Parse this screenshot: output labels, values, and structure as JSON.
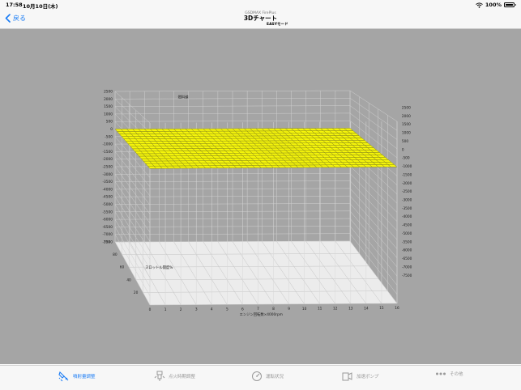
{
  "status": {
    "time": "17:58",
    "date": "10月10日(木)",
    "battery": "100%"
  },
  "nav": {
    "back_label": "戻る",
    "subtitle": "GSDMAX FirePlus",
    "title": "3Dチャート",
    "mode": "EASYモード"
  },
  "chart_data": {
    "type": "surface3d",
    "title": "燃料値",
    "xlabel": "エンジン回転数×4000rpm",
    "ylabel": "スロットル開度%",
    "x_ticks": [
      "0",
      "1",
      "2",
      "3",
      "4",
      "5",
      "6",
      "7",
      "8",
      "9",
      "10",
      "11",
      "12",
      "13",
      "14",
      "15",
      "16"
    ],
    "y_ticks": [
      "0",
      "20",
      "40",
      "60",
      "80",
      "100"
    ],
    "z_ticks_left": [
      "2500",
      "2000",
      "1500",
      "1000",
      "500",
      "0",
      "-500",
      "-1000",
      "-1500",
      "-2000",
      "-2500",
      "-3000",
      "-3500",
      "-4000",
      "-4500",
      "-5000",
      "-5500",
      "-6000",
      "-6500",
      "-7000",
      "-7500"
    ],
    "z_ticks_right": [
      "2500",
      "2000",
      "1500",
      "1000",
      "500",
      "0",
      "-500",
      "-1000",
      "-1500",
      "-2000",
      "-2500",
      "-3000",
      "-3500",
      "-4000",
      "-4500",
      "-5000",
      "-5500",
      "-6000",
      "-6500",
      "-7000",
      "-7500"
    ],
    "zlim": [
      -7500,
      2500
    ],
    "surface_value": 0,
    "surface_color": "#f5f50a",
    "background_color": "#a5a5a5",
    "grid": true
  },
  "tabs": [
    {
      "label": "噴射量調整",
      "icon": "injector-icon",
      "active": true
    },
    {
      "label": "点火時期調整",
      "icon": "ignition-icon",
      "active": false
    },
    {
      "label": "運転状況",
      "icon": "gauge-icon",
      "active": false
    },
    {
      "label": "加速ポンプ",
      "icon": "pump-icon",
      "active": false
    },
    {
      "label": "その他",
      "icon": "more-icon",
      "active": false
    }
  ],
  "colors": {
    "accent": "#1a7cf5",
    "inactive": "#999999"
  }
}
